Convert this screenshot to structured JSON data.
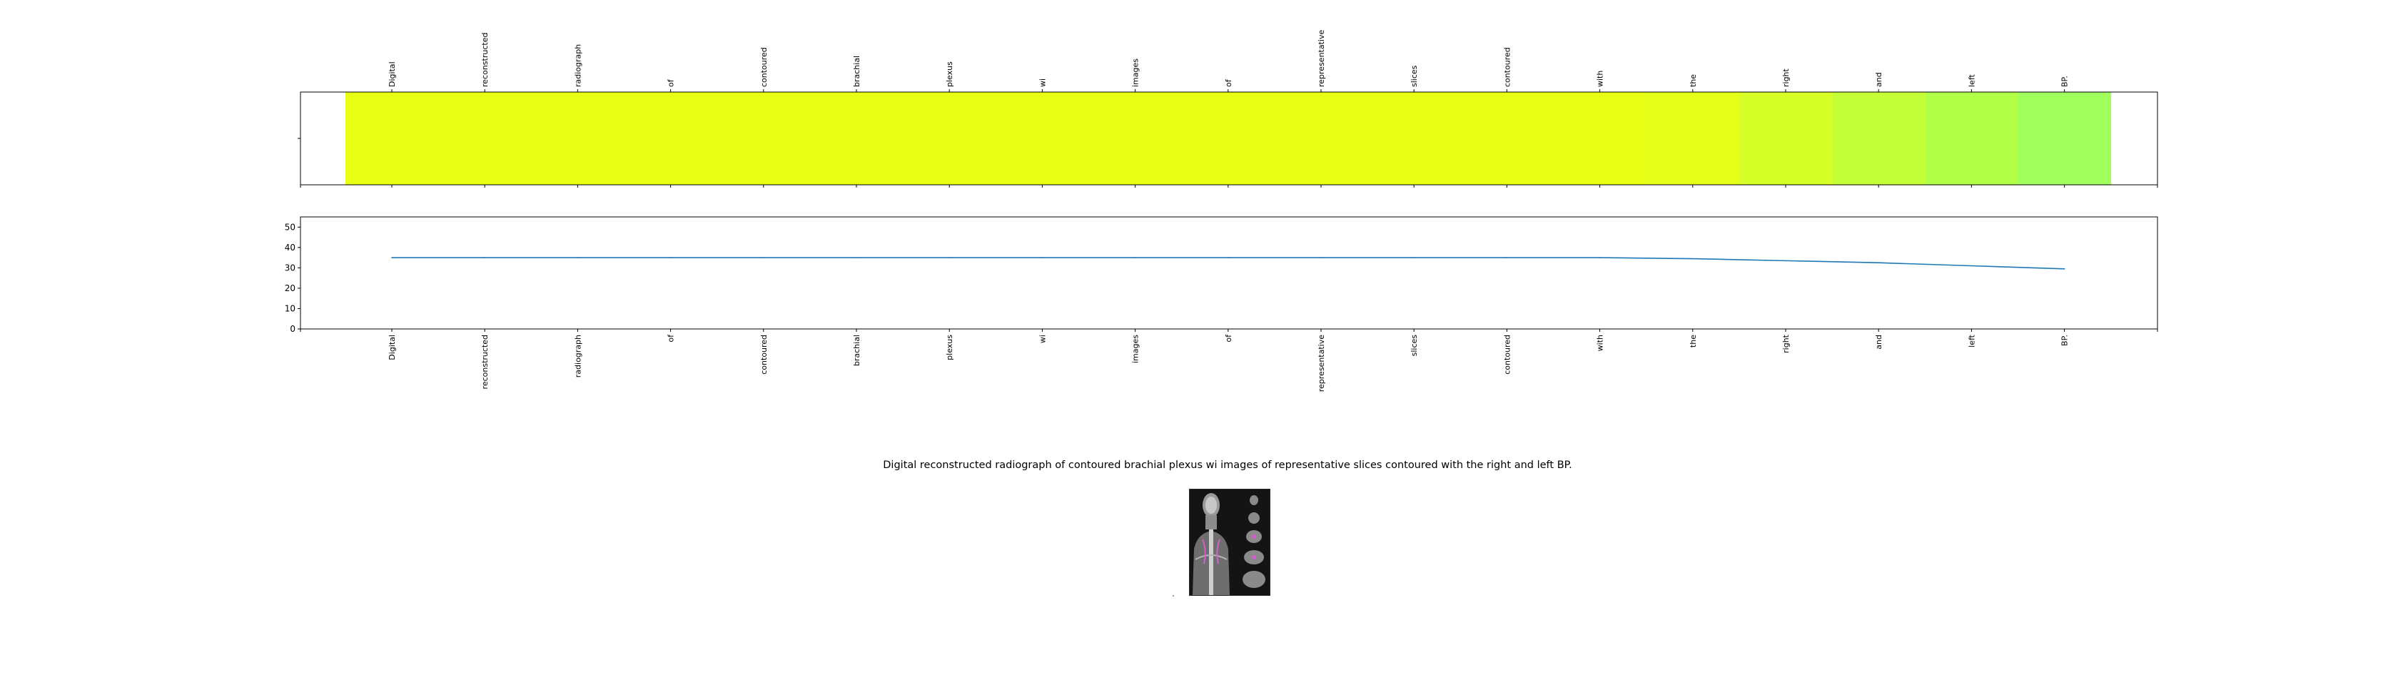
{
  "chart_data": [
    {
      "type": "heatmap",
      "categories": [
        "Digital",
        "reconstructed",
        "radiograph",
        "of",
        "contoured",
        "brachial",
        "plexus",
        "wi",
        "images",
        "of",
        "representative",
        "slices",
        "contoured",
        "with",
        "the",
        "right",
        "and",
        "left",
        "BP."
      ],
      "values": [
        35,
        35,
        35,
        35,
        35,
        35,
        35,
        35,
        35,
        35,
        35,
        35,
        35,
        35,
        34.5,
        33.5,
        32.5,
        31,
        29.5
      ],
      "colors": [
        "#e8ff14",
        "#e8ff14",
        "#e8ff14",
        "#e8ff14",
        "#e8ff14",
        "#e8ff14",
        "#e8ff14",
        "#e8ff14",
        "#e8ff14",
        "#e8ff14",
        "#e8ff14",
        "#e8ff14",
        "#e8ff14",
        "#e8ff14",
        "#e4ff18",
        "#d6ff28",
        "#c4ff37",
        "#b2ff48",
        "#a0ff5c"
      ],
      "tick_labels_position": "top"
    },
    {
      "type": "line",
      "x": [
        "Digital",
        "reconstructed",
        "radiograph",
        "of",
        "contoured",
        "brachial",
        "plexus",
        "wi",
        "images",
        "of",
        "representative",
        "slices",
        "contoured",
        "with",
        "the",
        "right",
        "and",
        "left",
        "BP."
      ],
      "series": [
        {
          "values": [
            35,
            35,
            35,
            35,
            35,
            35,
            35,
            35,
            35,
            35,
            35,
            35,
            35,
            35,
            34.5,
            33.5,
            32.5,
            31,
            29.5
          ],
          "color": "#1f77b4"
        }
      ],
      "ylim": [
        0,
        55
      ],
      "yticks": [
        "0",
        "10",
        "20",
        "30",
        "40",
        "50"
      ],
      "grid": false
    }
  ],
  "caption": "Digital reconstructed radiograph of contoured brachial plexus wi images of representative slices contoured with the right and left BP.",
  "image": {
    "icon": "ct-scan-thumbnail",
    "background": "#141414"
  }
}
